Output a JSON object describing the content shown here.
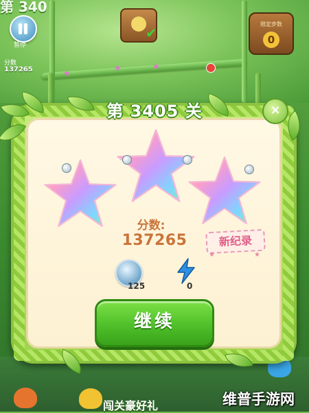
{
  "background": {
    "level_text": "第 340",
    "pause_label": "暂停",
    "score_text": "137265",
    "side_label": "分数",
    "target_label": "限定步数",
    "target_value": "0",
    "bottom_banner": "闯关豪好礼"
  },
  "dialog": {
    "title": "第 3405 关",
    "close_symbol": "×",
    "stars_earned": 3,
    "stars_total": 3,
    "score_label": "分数:",
    "score_value": "137265",
    "new_record_label": "新纪录",
    "boosters": [
      {
        "name": "coin",
        "count": "125"
      },
      {
        "name": "lightning",
        "count": "0"
      }
    ],
    "continue_label": "继续"
  },
  "watermark": "维普手游网",
  "colors": {
    "panel_frame": "#9fd24b",
    "panel_bg": "#fdf1d2",
    "score_text": "#c9743a",
    "button_green": "#4fc02a",
    "new_record": "#e0608a"
  },
  "icons": [
    "pause-icon",
    "close-icon",
    "rainbow-star-icon",
    "coin-icon",
    "lightning-icon",
    "chick-icon"
  ]
}
